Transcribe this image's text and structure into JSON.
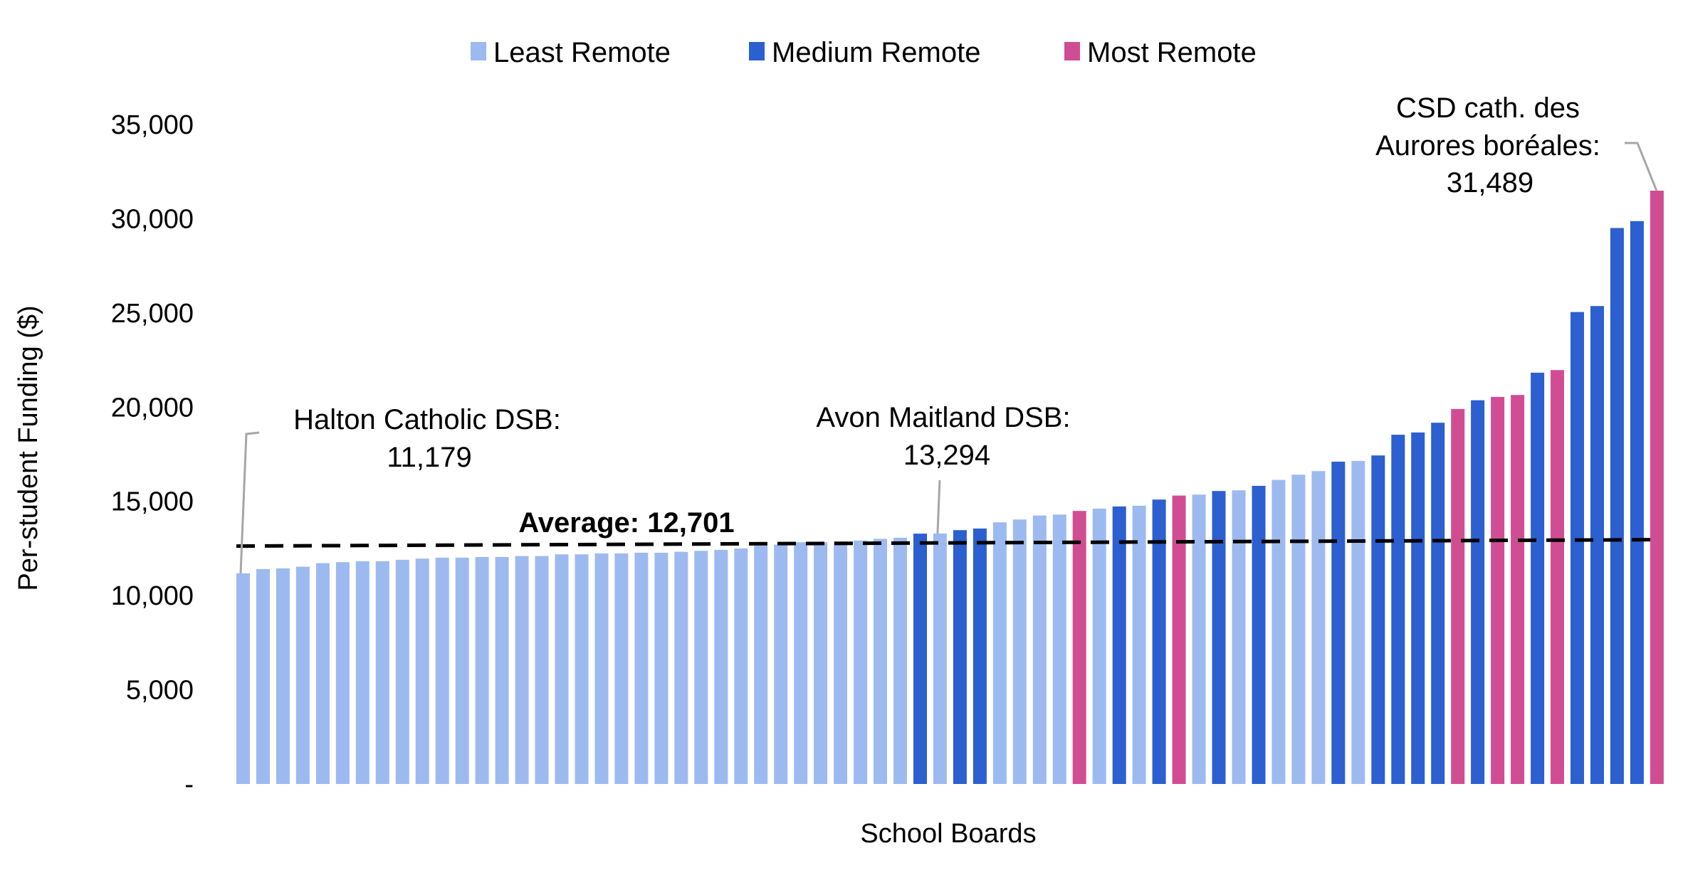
{
  "chart_data": {
    "type": "bar",
    "title": "",
    "xlabel": "School Boards",
    "ylabel": "Per-student Funding ($)",
    "ylim": [
      0,
      35000
    ],
    "yticks": [
      0,
      5000,
      10000,
      15000,
      20000,
      25000,
      30000,
      35000
    ],
    "ytick_labels": [
      "-",
      "5,000",
      "10,000",
      "15,000",
      "20,000",
      "25,000",
      "30,000",
      "35,000"
    ],
    "grid": false,
    "legend": {
      "placement": "top-center",
      "entries": [
        {
          "key": "least",
          "label": "Least Remote",
          "color": "#9dbaf0"
        },
        {
          "key": "medium",
          "label": "Medium Remote",
          "color": "#2c5fcf"
        },
        {
          "key": "most",
          "label": "Most Remote",
          "color": "#d14d93"
        }
      ]
    },
    "bars": [
      {
        "value": 11179,
        "group": "least"
      },
      {
        "value": 11405,
        "group": "least"
      },
      {
        "value": 11443,
        "group": "least"
      },
      {
        "value": 11530,
        "group": "least"
      },
      {
        "value": 11719,
        "group": "least"
      },
      {
        "value": 11771,
        "group": "least"
      },
      {
        "value": 11820,
        "group": "least"
      },
      {
        "value": 11820,
        "group": "least"
      },
      {
        "value": 11896,
        "group": "least"
      },
      {
        "value": 11960,
        "group": "least"
      },
      {
        "value": 12009,
        "group": "least"
      },
      {
        "value": 12009,
        "group": "least"
      },
      {
        "value": 12047,
        "group": "least"
      },
      {
        "value": 12047,
        "group": "least"
      },
      {
        "value": 12097,
        "group": "least"
      },
      {
        "value": 12097,
        "group": "least"
      },
      {
        "value": 12187,
        "group": "least"
      },
      {
        "value": 12187,
        "group": "least"
      },
      {
        "value": 12236,
        "group": "least"
      },
      {
        "value": 12236,
        "group": "least"
      },
      {
        "value": 12273,
        "group": "least"
      },
      {
        "value": 12273,
        "group": "least"
      },
      {
        "value": 12323,
        "group": "least"
      },
      {
        "value": 12374,
        "group": "least"
      },
      {
        "value": 12424,
        "group": "least"
      },
      {
        "value": 12500,
        "group": "least"
      },
      {
        "value": 12651,
        "group": "least"
      },
      {
        "value": 12700,
        "group": "least"
      },
      {
        "value": 12828,
        "group": "least"
      },
      {
        "value": 12828,
        "group": "least"
      },
      {
        "value": 12878,
        "group": "least"
      },
      {
        "value": 12920,
        "group": "least"
      },
      {
        "value": 13010,
        "group": "least"
      },
      {
        "value": 13066,
        "group": "least"
      },
      {
        "value": 13285,
        "group": "medium"
      },
      {
        "value": 13294,
        "group": "least"
      },
      {
        "value": 13470,
        "group": "medium"
      },
      {
        "value": 13557,
        "group": "medium"
      },
      {
        "value": 13885,
        "group": "least"
      },
      {
        "value": 14036,
        "group": "least"
      },
      {
        "value": 14248,
        "group": "least"
      },
      {
        "value": 14300,
        "group": "least"
      },
      {
        "value": 14490,
        "group": "most"
      },
      {
        "value": 14615,
        "group": "least"
      },
      {
        "value": 14728,
        "group": "medium"
      },
      {
        "value": 14766,
        "group": "least"
      },
      {
        "value": 15094,
        "group": "medium"
      },
      {
        "value": 15308,
        "group": "most"
      },
      {
        "value": 15358,
        "group": "least"
      },
      {
        "value": 15547,
        "group": "medium"
      },
      {
        "value": 15585,
        "group": "least"
      },
      {
        "value": 15823,
        "group": "medium"
      },
      {
        "value": 16137,
        "group": "least"
      },
      {
        "value": 16416,
        "group": "least"
      },
      {
        "value": 16605,
        "group": "least"
      },
      {
        "value": 17107,
        "group": "medium"
      },
      {
        "value": 17145,
        "group": "least"
      },
      {
        "value": 17436,
        "group": "medium"
      },
      {
        "value": 18534,
        "group": "medium"
      },
      {
        "value": 18656,
        "group": "medium"
      },
      {
        "value": 19173,
        "group": "medium"
      },
      {
        "value": 19902,
        "group": "most"
      },
      {
        "value": 20367,
        "group": "medium"
      },
      {
        "value": 20544,
        "group": "most"
      },
      {
        "value": 20645,
        "group": "most"
      },
      {
        "value": 21828,
        "group": "medium"
      },
      {
        "value": 21967,
        "group": "most"
      },
      {
        "value": 25049,
        "group": "medium"
      },
      {
        "value": 25366,
        "group": "medium"
      },
      {
        "value": 29506,
        "group": "medium"
      },
      {
        "value": 29872,
        "group": "medium"
      },
      {
        "value": 31489,
        "group": "most"
      }
    ],
    "average": {
      "value": 12701,
      "label": "Average: 12,701",
      "style": "dashed",
      "color": "#000000"
    },
    "annotations": [
      {
        "bar_index": 0,
        "lines": [
          "Halton Catholic DSB:",
          "11,179"
        ]
      },
      {
        "bar_index": 35,
        "lines": [
          "Avon Maitland DSB:",
          "13,294"
        ]
      },
      {
        "bar_index": 71,
        "lines": [
          "CSD cath. des",
          "Aurores boréales:",
          "31,489"
        ]
      }
    ],
    "leader_line_color": "#a6a6a6"
  }
}
